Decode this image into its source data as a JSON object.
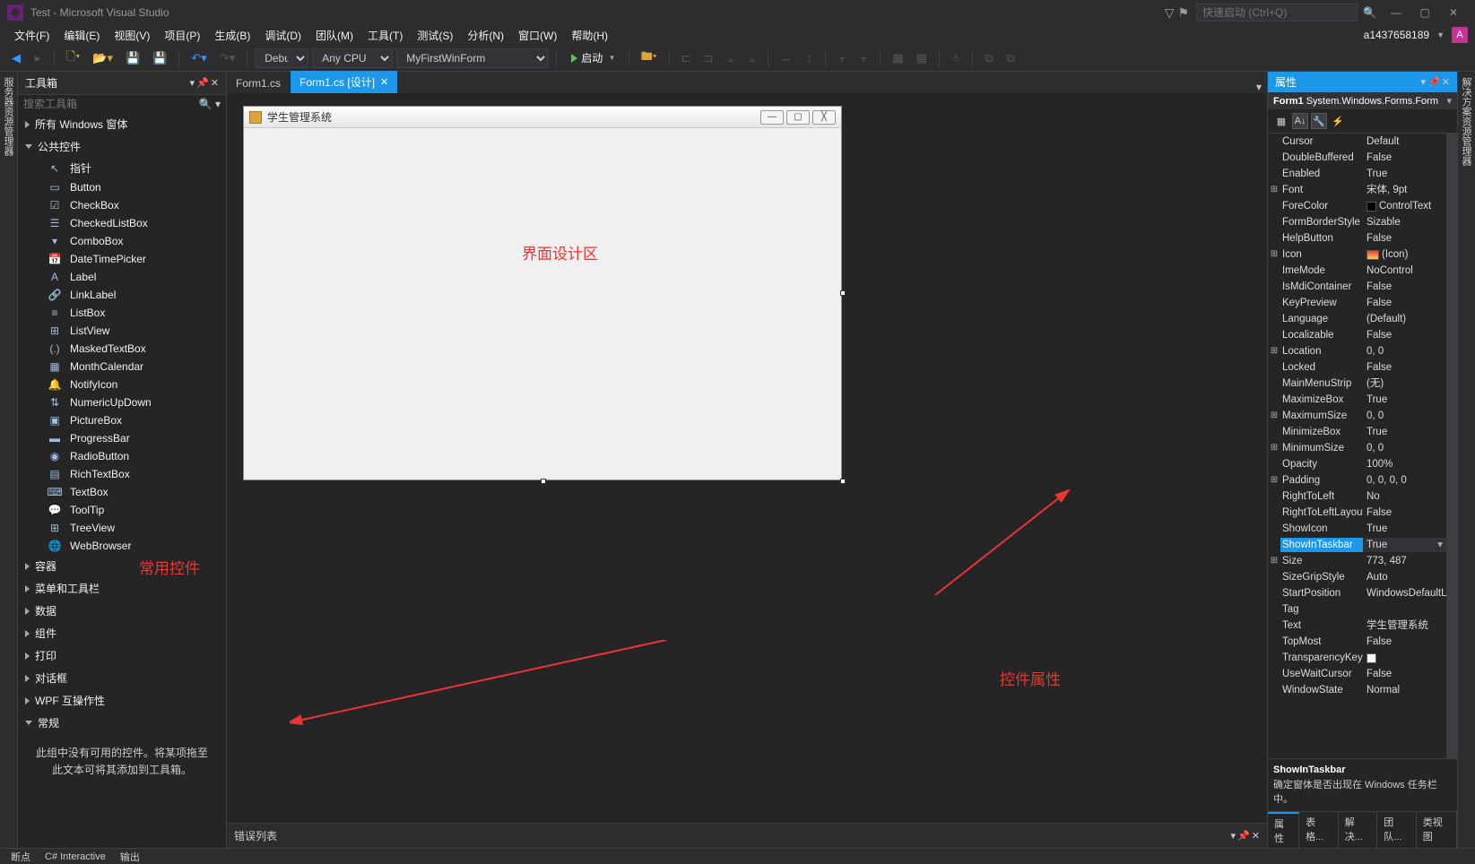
{
  "title": "Test - Microsoft Visual Studio",
  "quick_launch_placeholder": "快速启动 (Ctrl+Q)",
  "account": "a1437658189",
  "menu": [
    "文件(F)",
    "编辑(E)",
    "视图(V)",
    "项目(P)",
    "生成(B)",
    "调试(D)",
    "团队(M)",
    "工具(T)",
    "测试(S)",
    "分析(N)",
    "窗口(W)",
    "帮助(H)"
  ],
  "toolbar": {
    "config": "Debug",
    "platform": "Any CPU",
    "project": "MyFirstWinForm",
    "start": "启动"
  },
  "side_left": "服务器资源管理器",
  "side_right": "解决方案资源管理器",
  "toolbox": {
    "title": "工具箱",
    "search_placeholder": "搜索工具箱",
    "cat_all": "所有 Windows 窗体",
    "cat_common": "公共控件",
    "items": [
      "指针",
      "Button",
      "CheckBox",
      "CheckedListBox",
      "ComboBox",
      "DateTimePicker",
      "Label",
      "LinkLabel",
      "ListBox",
      "ListView",
      "MaskedTextBox",
      "MonthCalendar",
      "NotifyIcon",
      "NumericUpDown",
      "PictureBox",
      "ProgressBar",
      "RadioButton",
      "RichTextBox",
      "TextBox",
      "ToolTip",
      "TreeView",
      "WebBrowser"
    ],
    "cat_container": "容器",
    "cat_menu": "菜单和工具栏",
    "cat_data": "数据",
    "cat_component": "组件",
    "cat_print": "打印",
    "cat_dialog": "对话框",
    "cat_wpf": "WPF 互操作性",
    "cat_general": "常规",
    "general_text": "此组中没有可用的控件。将某项拖至此文本可将其添加到工具箱。"
  },
  "tabs": [
    {
      "label": "Form1.cs",
      "active": false
    },
    {
      "label": "Form1.cs [设计]",
      "active": true
    }
  ],
  "form_window_title": "学生管理系统",
  "errlist_title": "错误列表",
  "annotations": {
    "design": "界面设计区",
    "toolbox": "常用控件",
    "props": "控件属性"
  },
  "props": {
    "title": "属性",
    "object_name": "Form1",
    "object_type": "System.Windows.Forms.Form",
    "rows": [
      {
        "exp": "",
        "name": "Cursor",
        "val": "Default"
      },
      {
        "exp": "",
        "name": "DoubleBuffered",
        "val": "False"
      },
      {
        "exp": "",
        "name": "Enabled",
        "val": "True"
      },
      {
        "exp": "⊞",
        "name": "Font",
        "val": "宋体, 9pt"
      },
      {
        "exp": "",
        "name": "ForeColor",
        "val": "ControlText",
        "color": "#000"
      },
      {
        "exp": "",
        "name": "FormBorderStyle",
        "val": "Sizable"
      },
      {
        "exp": "",
        "name": "HelpButton",
        "val": "False"
      },
      {
        "exp": "⊞",
        "name": "Icon",
        "val": "(Icon)",
        "icon": true
      },
      {
        "exp": "",
        "name": "ImeMode",
        "val": "NoControl"
      },
      {
        "exp": "",
        "name": "IsMdiContainer",
        "val": "False"
      },
      {
        "exp": "",
        "name": "KeyPreview",
        "val": "False"
      },
      {
        "exp": "",
        "name": "Language",
        "val": "(Default)"
      },
      {
        "exp": "",
        "name": "Localizable",
        "val": "False"
      },
      {
        "exp": "⊞",
        "name": "Location",
        "val": "0, 0"
      },
      {
        "exp": "",
        "name": "Locked",
        "val": "False"
      },
      {
        "exp": "",
        "name": "MainMenuStrip",
        "val": "(无)"
      },
      {
        "exp": "",
        "name": "MaximizeBox",
        "val": "True"
      },
      {
        "exp": "⊞",
        "name": "MaximumSize",
        "val": "0, 0"
      },
      {
        "exp": "",
        "name": "MinimizeBox",
        "val": "True"
      },
      {
        "exp": "⊞",
        "name": "MinimumSize",
        "val": "0, 0"
      },
      {
        "exp": "",
        "name": "Opacity",
        "val": "100%"
      },
      {
        "exp": "⊞",
        "name": "Padding",
        "val": "0, 0, 0, 0"
      },
      {
        "exp": "",
        "name": "RightToLeft",
        "val": "No"
      },
      {
        "exp": "",
        "name": "RightToLeftLayout",
        "val": "False"
      },
      {
        "exp": "",
        "name": "ShowIcon",
        "val": "True"
      },
      {
        "exp": "",
        "name": "ShowInTaskbar",
        "val": "True",
        "selected": true
      },
      {
        "exp": "⊞",
        "name": "Size",
        "val": "773, 487"
      },
      {
        "exp": "",
        "name": "SizeGripStyle",
        "val": "Auto"
      },
      {
        "exp": "",
        "name": "StartPosition",
        "val": "WindowsDefaultLo"
      },
      {
        "exp": "",
        "name": "Tag",
        "val": ""
      },
      {
        "exp": "",
        "name": "Text",
        "val": "学生管理系统"
      },
      {
        "exp": "",
        "name": "TopMost",
        "val": "False"
      },
      {
        "exp": "",
        "name": "TransparencyKey",
        "val": "",
        "color": "#fff"
      },
      {
        "exp": "",
        "name": "UseWaitCursor",
        "val": "False"
      },
      {
        "exp": "",
        "name": "WindowState",
        "val": "Normal"
      }
    ],
    "desc_name": "ShowInTaskbar",
    "desc_text": "确定窗体是否出现在 Windows 任务栏中。",
    "bottom_tabs": [
      "属性",
      "表格...",
      "解决...",
      "团队...",
      "类视图"
    ]
  },
  "status": [
    "断点",
    "C# Interactive",
    "输出"
  ]
}
